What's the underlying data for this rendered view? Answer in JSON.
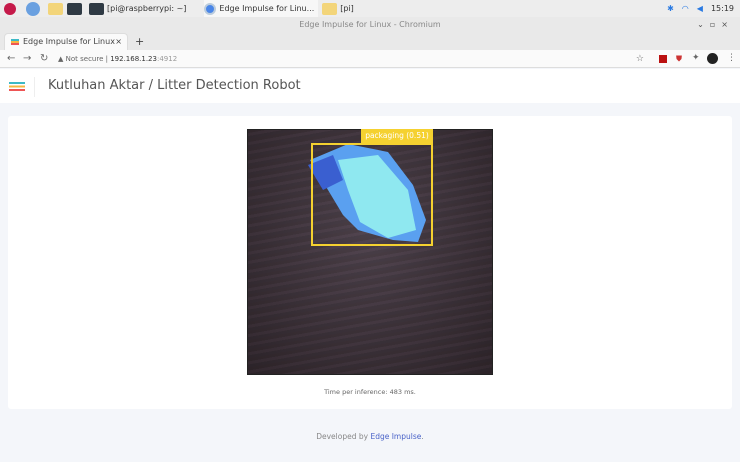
{
  "taskbar": {
    "terminal_label": "[pi@raspberrypi: ~]",
    "browser_label": "Edge Impulse for Linu...",
    "folder_label": "[pi]",
    "clock": "15:19"
  },
  "window": {
    "title": "Edge Impulse for Linux - Chromium"
  },
  "tab": {
    "label": "Edge Impulse for Linux",
    "close": "×",
    "new": "+"
  },
  "address": {
    "security": "Not secure",
    "url": "192.168.1.23",
    "port": ":4912"
  },
  "header": {
    "title": "Kutluhan Aktar / Litter Detection Robot"
  },
  "detection": {
    "label": "packaging (0.51)",
    "color": "#f5d130"
  },
  "stats": {
    "inference": "Time per inference: 483 ms."
  },
  "footer": {
    "prefix": "Developed by ",
    "link": "Edge Impulse",
    "suffix": "."
  }
}
